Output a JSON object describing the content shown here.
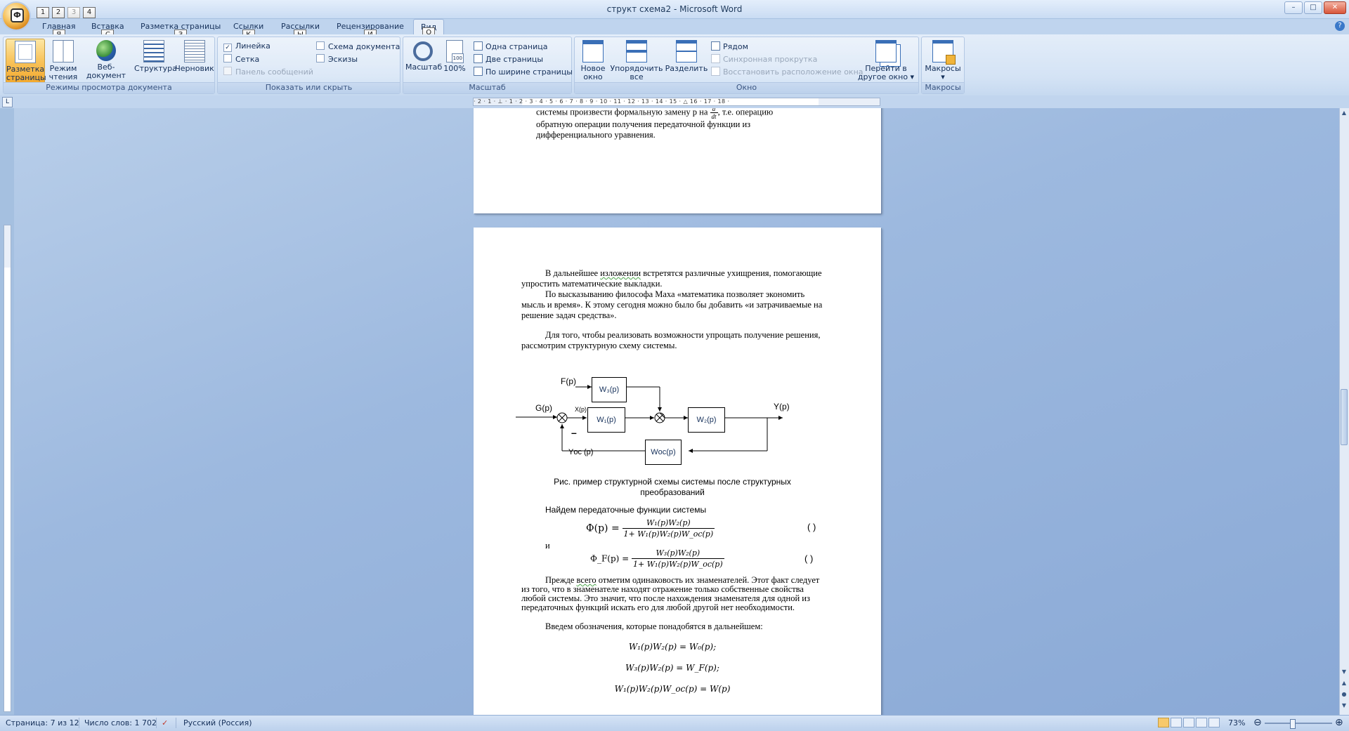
{
  "window": {
    "title": "структ схема2 - Microsoft Word"
  },
  "office_button": {
    "keytip": "Ф"
  },
  "qat": {
    "keytips": [
      "1",
      "2",
      "3",
      "4"
    ]
  },
  "tabs": [
    {
      "label": "Главная",
      "keytip": "Я"
    },
    {
      "label": "Вставка",
      "keytip": "С"
    },
    {
      "label": "Разметка страницы",
      "keytip": "З"
    },
    {
      "label": "Ссылки",
      "keytip": "К"
    },
    {
      "label": "Рассылки",
      "keytip": "Ы"
    },
    {
      "label": "Рецензирование",
      "keytip": "И"
    },
    {
      "label": "Вид",
      "keytip": "О"
    }
  ],
  "ribbon": {
    "views": {
      "label": "Режимы просмотра документа",
      "buttons": [
        {
          "label": "Разметка страницы",
          "icon": "page-layout-icon",
          "selected": true
        },
        {
          "label": "Режим чтения",
          "icon": "reading-icon"
        },
        {
          "label": "Веб-документ",
          "icon": "web-icon"
        },
        {
          "label": "Структура",
          "icon": "outline-icon"
        },
        {
          "label": "Черновик",
          "icon": "draft-icon"
        }
      ]
    },
    "show": {
      "label": "Показать или скрыть",
      "checks": [
        {
          "label": "Линейка",
          "checked": true
        },
        {
          "label": "Сетка",
          "checked": false
        },
        {
          "label": "Панель сообщений",
          "checked": false,
          "disabled": true
        },
        {
          "label": "Схема документа",
          "checked": false
        },
        {
          "label": "Эскизы",
          "checked": false
        }
      ]
    },
    "zoom": {
      "label": "Масштаб",
      "buttons": [
        {
          "label": "Масштаб"
        },
        {
          "label": "100%"
        }
      ],
      "small": [
        "Одна страница",
        "Две страницы",
        "По ширине страницы"
      ]
    },
    "window": {
      "label": "Окно",
      "buttons": [
        {
          "label": "Новое окно"
        },
        {
          "label": "Упорядочить все"
        },
        {
          "label": "Разделить"
        }
      ],
      "small": [
        {
          "label": "Рядом",
          "disabled": false
        },
        {
          "label": "Синхронная прокрутка",
          "disabled": true
        },
        {
          "label": "Восстановить расположение окна",
          "disabled": true
        }
      ],
      "switch": "Перейти в другое окно"
    },
    "macros": {
      "label": "Макросы",
      "button": "Макросы"
    }
  },
  "document": {
    "page1_lines": [
      "системы произвести формальную замену p на",
      ", т.е. операцию",
      "обратную операции получения передаточной функции из",
      "дифференциального уравнения."
    ],
    "frac_d": {
      "num": "d",
      "den": "dt"
    },
    "page2": {
      "para1_a": "В дальнейшее ",
      "para1_u": "изложении",
      "para1_b": " встретятся различные ухищрения, помогающие упростить математические выкладки.",
      "para2": "По высказыванию философа Маха «математика позволяет экономить мысль и время». К этому сегодня можно было бы добавить «и затрачиваемые на решение задач средства».",
      "para3": "Для того, чтобы реализовать возможности упрощать получение решения, рассмотрим структурную схему системы.",
      "diagram": {
        "F": "F(p)",
        "G": "G(p)",
        "X": "X(p)",
        "Y": "Y(p)",
        "Yoc": "Yос (p)",
        "W3": "W₃(p)",
        "W1": "W₁(p)",
        "W2": "W₂(p)",
        "Woc": "Wос(p)",
        "minus": "–"
      },
      "caption": "Рис.    пример структурной схемы системы после структурных преобразований",
      "find": "Найдем передаточные функции системы",
      "eq1": {
        "lhs": "Ф(p) =",
        "num": "W₁(p)W₂(p)",
        "den": "1+ W₁(p)W₂(p)W_oc(p)",
        "num_label": "( )"
      },
      "and": "и",
      "eq2": {
        "lhs": "Ф_F(p) =",
        "num": "W₃(p)W₂(p)",
        "den": "1+ W₁(p)W₂(p)W_oc(p)",
        "num_label": "( )"
      },
      "para4_a": "Прежде ",
      "para4_u": "всего",
      "para4_b": " отметим одинаковость их знаменателей. Этот факт следует из того, что в знаменателе находят отражение только собственные свойства любой системы. Это значит, что после нахождения знаменателя для одной из передаточных функций искать его для любой другой нет необходимости.",
      "para5": "Введем  обозначения, которые понадобятся в дальнейшем:",
      "def1": "W₁(p)W₂(p) = W₀(p);",
      "def2": "W₃(p)W₂(p) = W_F(p);",
      "def3": "W₁(p)W₂(p)W_oc(p) = W(p)"
    }
  },
  "ruler_text": "· 2 · 1 · ⊥ · 1 · 2 · 3 · 4 · 5 · 6 · 7 · 8 · 9 · 10 · 11 · 12 · 13 · 14 · 15 · △ 16 · 17 · 18 ·",
  "status": {
    "page": "Страница: 7 из 12",
    "words": "Число слов: 1 702",
    "lang": "Русский (Россия)",
    "zoom": "73%",
    "zoom_value": 0.73
  }
}
